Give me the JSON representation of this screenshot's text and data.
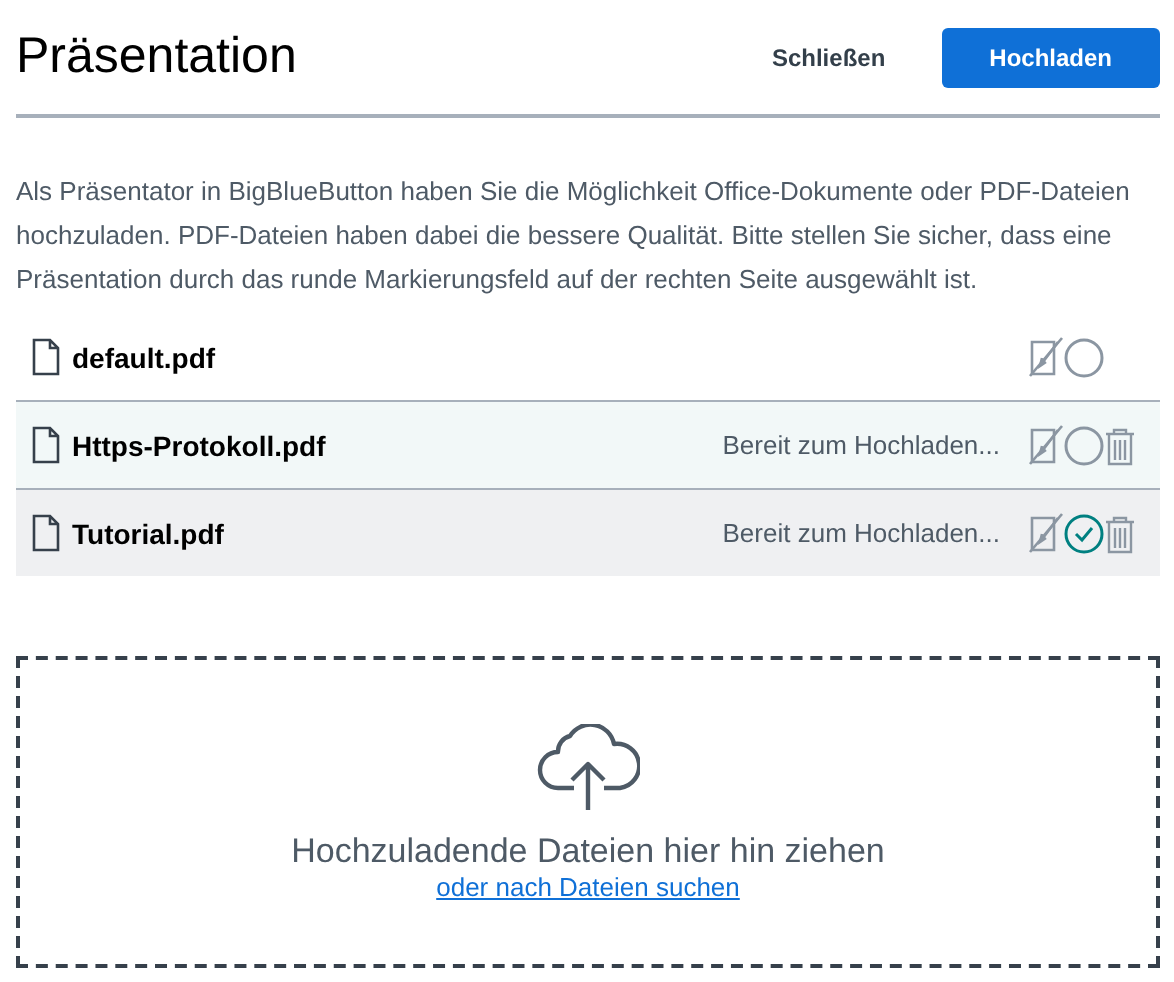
{
  "header": {
    "title": "Präsentation",
    "buttons": [
      {
        "label": "Schließen",
        "kind": "plain"
      },
      {
        "label": "Hochladen",
        "kind": "primary"
      }
    ]
  },
  "intro": "Als Präsentator in BigBlueButton haben Sie die Möglichkeit Office-Dokumente oder PDF-Dateien hochzuladen. PDF-Dateien haben dabei die bessere Qualität. Bitte stellen Sie sicher, dass eine Präsentation durch das runde Markierungsfeld auf der rechten Seite ausgewählt ist.",
  "files": [
    {
      "name": "default.pdf",
      "selected": false,
      "deletable": false,
      "color": "#ffffff"
    },
    {
      "name": "Https-Protokoll.pdf",
      "status": "Bereit zum Hochladen...",
      "selected": false,
      "deletable": true,
      "color": "#f2f8f8"
    },
    {
      "name": "Tutorial.pdf",
      "status": "Bereit zum Hochladen...",
      "selected": true,
      "deletable": true,
      "color": "#eff0f2"
    }
  ],
  "dropzone": {
    "message": "Hochzuladende Dateien hier hin ziehen",
    "link": "oder nach Dateien suchen"
  }
}
